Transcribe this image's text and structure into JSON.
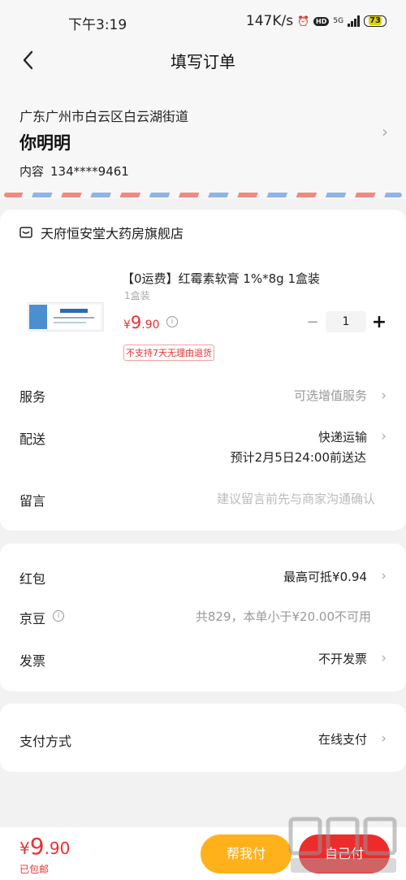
{
  "status_bar": {
    "time": "下午3:19",
    "speed": "147K/s",
    "hd": "HD",
    "signal": "5G",
    "battery": "73"
  },
  "nav": {
    "title": "填写订单"
  },
  "address": {
    "line": "广东广州市白云区白云湖街道",
    "name": "你明明",
    "phone_label": "内容",
    "phone": "134****9461"
  },
  "store": {
    "name": "天府恒安堂大药房旗舰店"
  },
  "product": {
    "title": "【0运费】红霉素软膏 1%*8g 1盒装",
    "spec": "1盒装",
    "price_symbol": "¥",
    "price_int": "9",
    "price_dec": ".90",
    "tag": "不支持7天无理由退货",
    "quantity": "1"
  },
  "rows": {
    "service_label": "服务",
    "service_value": "可选增值服务",
    "delivery_label": "配送",
    "delivery_value": "快递运输",
    "delivery_eta": "预计2月5日24:00前送达",
    "note_label": "留言",
    "note_placeholder": "建议留言前先与商家沟通确认",
    "redpacket_label": "红包",
    "redpacket_value": "最高可抵¥0.94",
    "jingdou_label": "京豆",
    "jingdou_value": "共829，本单小于¥20.00不可用",
    "invoice_label": "发票",
    "invoice_value": "不开发票",
    "payment_label": "支付方式",
    "payment_value": "在线支付"
  },
  "footer": {
    "symbol": "¥",
    "total_int": "9",
    "total_dec": ".90",
    "shipping": "已包邮",
    "help_pay": "帮我付",
    "self_pay": "自己付"
  },
  "colors": {
    "price": "#ee3030",
    "help_button": "#ffb11b",
    "pay_button": "#ee2b2b"
  }
}
